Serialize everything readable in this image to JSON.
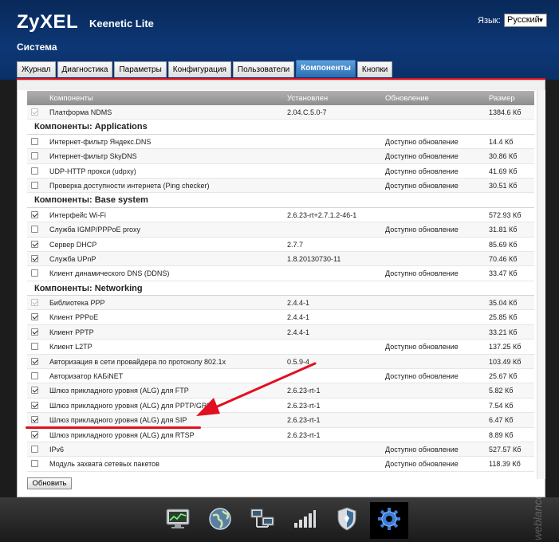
{
  "header": {
    "brand": "ZyXEL",
    "model": "Keenetic Lite",
    "language_label": "Язык:",
    "language_value": "Русский",
    "section_title": "Система"
  },
  "tabs": [
    {
      "label": "Журнал",
      "active": false
    },
    {
      "label": "Диагностика",
      "active": false
    },
    {
      "label": "Параметры",
      "active": false
    },
    {
      "label": "Конфигурация",
      "active": false
    },
    {
      "label": "Пользователи",
      "active": false
    },
    {
      "label": "Компоненты",
      "active": true
    },
    {
      "label": "Кнопки",
      "active": false
    }
  ],
  "table": {
    "columns": {
      "name": "Компоненты",
      "version": "Установлен",
      "update": "Обновление",
      "size": "Размер"
    },
    "rows": [
      {
        "kind": "item",
        "checked": true,
        "disabled": true,
        "name": "Платформа NDMS",
        "version": "2.04.C.5.0-7",
        "update": "",
        "size": "1384.6 Кб"
      },
      {
        "kind": "group",
        "name": "Компоненты: Applications"
      },
      {
        "kind": "item",
        "checked": false,
        "disabled": false,
        "name": "Интернет-фильтр Яндекс.DNS",
        "version": "",
        "update": "Доступно обновление",
        "size": "14.4 Кб"
      },
      {
        "kind": "item",
        "checked": false,
        "disabled": false,
        "name": "Интернет-фильтр SkyDNS",
        "version": "",
        "update": "Доступно обновление",
        "size": "30.86 Кб"
      },
      {
        "kind": "item",
        "checked": false,
        "disabled": false,
        "name": "UDP-HTTP прокси (udpxy)",
        "version": "",
        "update": "Доступно обновление",
        "size": "41.69 Кб"
      },
      {
        "kind": "item",
        "checked": false,
        "disabled": false,
        "name": "Проверка доступности интернета (Ping checker)",
        "version": "",
        "update": "Доступно обновление",
        "size": "30.51 Кб"
      },
      {
        "kind": "group",
        "name": "Компоненты: Base system"
      },
      {
        "kind": "item",
        "checked": true,
        "disabled": false,
        "name": "Интерфейс Wi-Fi",
        "version": "2.6.23-rt+2.7.1.2-46-1",
        "update": "",
        "size": "572.93 Кб"
      },
      {
        "kind": "item",
        "checked": false,
        "disabled": false,
        "name": "Служба IGMP/PPPoE proxy",
        "version": "",
        "update": "Доступно обновление",
        "size": "31.81 Кб"
      },
      {
        "kind": "item",
        "checked": true,
        "disabled": false,
        "name": "Сервер DHCP",
        "version": "2.7.7",
        "update": "",
        "size": "85.69 Кб"
      },
      {
        "kind": "item",
        "checked": true,
        "disabled": false,
        "name": "Служба UPnP",
        "version": "1.8.20130730-11",
        "update": "",
        "size": "70.46 Кб"
      },
      {
        "kind": "item",
        "checked": false,
        "disabled": false,
        "name": "Клиент динамического DNS (DDNS)",
        "version": "",
        "update": "Доступно обновление",
        "size": "33.47 Кб"
      },
      {
        "kind": "group",
        "name": "Компоненты: Networking"
      },
      {
        "kind": "item",
        "checked": true,
        "disabled": true,
        "name": "Библиотека PPP",
        "version": "2.4.4-1",
        "update": "",
        "size": "35.04 Кб"
      },
      {
        "kind": "item",
        "checked": true,
        "disabled": false,
        "name": "Клиент PPPoE",
        "version": "2.4.4-1",
        "update": "",
        "size": "25.85 Кб"
      },
      {
        "kind": "item",
        "checked": true,
        "disabled": false,
        "name": "Клиент PPTP",
        "version": "2.4.4-1",
        "update": "",
        "size": "33.21 Кб"
      },
      {
        "kind": "item",
        "checked": false,
        "disabled": false,
        "name": "Клиент L2TP",
        "version": "",
        "update": "Доступно обновление",
        "size": "137.25 Кб"
      },
      {
        "kind": "item",
        "checked": true,
        "disabled": false,
        "name": "Авторизация в сети провайдера по протоколу 802.1x",
        "version": "0.5.9-4",
        "update": "",
        "size": "103.49 Кб"
      },
      {
        "kind": "item",
        "checked": false,
        "disabled": false,
        "name": "Авторизатор КАБiNET",
        "version": "",
        "update": "Доступно обновление",
        "size": "25.67 Кб"
      },
      {
        "kind": "item",
        "checked": true,
        "disabled": false,
        "name": "Шлюз прикладного уровня (ALG) для FTP",
        "version": "2.6.23-rt-1",
        "update": "",
        "size": "5.82 Кб"
      },
      {
        "kind": "item",
        "checked": true,
        "disabled": false,
        "name": "Шлюз прикладного уровня (ALG) для PPTP/GRE",
        "version": "2.6.23-rt-1",
        "update": "",
        "size": "7.54 Кб"
      },
      {
        "kind": "item",
        "checked": true,
        "disabled": false,
        "name": "Шлюз прикладного уровня (ALG) для SIP",
        "version": "2.6.23-rt-1",
        "update": "",
        "size": "6.47 Кб"
      },
      {
        "kind": "item",
        "checked": true,
        "disabled": false,
        "name": "Шлюз прикладного уровня (ALG) для RTSP",
        "version": "2.6.23-rt-1",
        "update": "",
        "size": "8.89 Кб"
      },
      {
        "kind": "item",
        "checked": false,
        "disabled": false,
        "name": "IPv6",
        "version": "",
        "update": "Доступно обновление",
        "size": "527.57 Кб"
      },
      {
        "kind": "item",
        "checked": false,
        "disabled": false,
        "name": "Модуль захвата сетевых пакетов",
        "version": "",
        "update": "Доступно обновление",
        "size": "118.39 Кб"
      }
    ]
  },
  "actions": {
    "update_button": "Обновить"
  },
  "taskbar": [
    {
      "icon": "monitor-chart-icon",
      "active": false
    },
    {
      "icon": "globe-icon",
      "active": false
    },
    {
      "icon": "network-computers-icon",
      "active": false
    },
    {
      "icon": "signal-bars-icon",
      "active": false
    },
    {
      "icon": "shield-icon",
      "active": false
    },
    {
      "icon": "gear-icon",
      "active": true
    }
  ],
  "watermark": "weblance.com.ua",
  "colors": {
    "header_bg": "#0d3775",
    "tab_active": "#2a6db3",
    "accent_red": "#e01020",
    "table_header": "#9e9e9e"
  }
}
